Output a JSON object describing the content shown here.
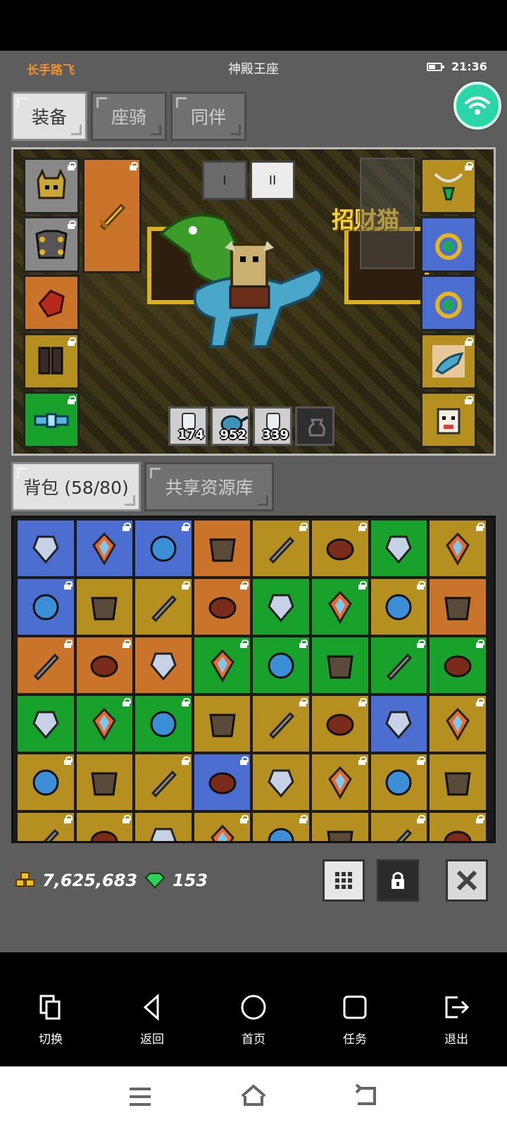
{
  "status": {
    "player_name": "长手路飞",
    "map_name": "神殿王座",
    "time": "21:36"
  },
  "equip_tabs": [
    {
      "label": "装备",
      "active": true
    },
    {
      "label": "座骑",
      "active": false
    },
    {
      "label": "同伴",
      "active": false
    }
  ],
  "scene": {
    "page_buttons": [
      {
        "label": "I",
        "active": false
      },
      {
        "label": "II",
        "active": true
      }
    ],
    "sign_text": "招财猫",
    "left_slots": [
      "helmet",
      "armor",
      "gloves",
      "boots",
      "belt"
    ],
    "right_slots": [
      "necklace",
      "ring",
      "ring",
      "pet-dino",
      "pet-lucky-cat"
    ],
    "weapon_slot": "golden-sword"
  },
  "potions": [
    {
      "name": "hp-potion",
      "count": "174"
    },
    {
      "name": "teapot",
      "count": "952"
    },
    {
      "name": "mp-potion",
      "count": "339"
    },
    {
      "name": "empty-jar",
      "count": ""
    }
  ],
  "inventory_tabs": [
    {
      "label": "背包 (58/80)",
      "active": true
    },
    {
      "label": "共享资源库",
      "active": false
    }
  ],
  "inventory": [
    "blue",
    "blue",
    "blue",
    "orange",
    "yellow",
    "yellow",
    "green",
    "yellow",
    "blue",
    "yellow",
    "yellow",
    "orange",
    "green",
    "green",
    "yellow",
    "orange",
    "orange",
    "orange",
    "orange",
    "green",
    "green",
    "green",
    "green",
    "green",
    "green",
    "green",
    "green",
    "yellow",
    "yellow",
    "yellow",
    "blue",
    "yellow",
    "yellow",
    "yellow",
    "yellow",
    "blue",
    "yellow",
    "yellow",
    "yellow",
    "yellow",
    "yellow",
    "yellow",
    "yellow",
    "yellow",
    "yellow",
    "yellow",
    "yellow",
    "yellow"
  ],
  "currency": {
    "gold": "7,625,683",
    "gems": "153"
  },
  "nav": [
    {
      "label": "切换",
      "icon": "switch-icon"
    },
    {
      "label": "返回",
      "icon": "back-icon"
    },
    {
      "label": "首页",
      "icon": "home-icon"
    },
    {
      "label": "任务",
      "icon": "task-icon"
    },
    {
      "label": "退出",
      "icon": "exit-icon"
    }
  ],
  "colors": {
    "gray": "#888888",
    "orange": "#c9742a",
    "yellow": "#b58f1f",
    "green": "#18a22c",
    "blue": "#4b6ed0",
    "player_name": "#f0902e",
    "wifi": "#2ad6a7"
  }
}
